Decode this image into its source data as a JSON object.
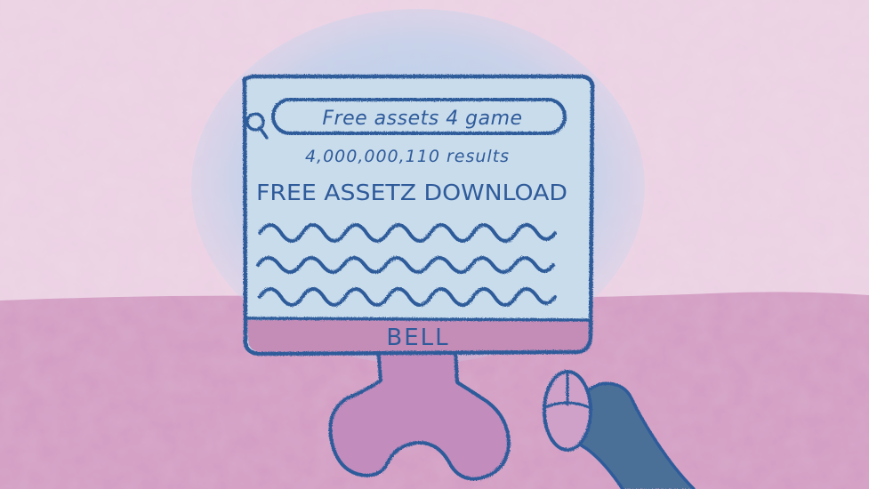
{
  "search": {
    "query": "Free assets 4 game"
  },
  "results": {
    "count_text": "4,000,000,110 results",
    "first_result_title": "FREE ASSETZ DOWNLOAD"
  },
  "monitor": {
    "brand": "BELL"
  },
  "colors": {
    "wall": "#ebd1e3",
    "desk": "#d39cc3",
    "screen": "#c9dcec",
    "glow": "#a9cdea",
    "outline": "#2f5b9a",
    "bezel": "#c48db8",
    "stand": "#c28cbd",
    "hand": "#4b6f98"
  },
  "icons": {
    "search": "magnifier-icon",
    "cursor": "mouse-icon",
    "hand": "hand-arm-icon"
  }
}
